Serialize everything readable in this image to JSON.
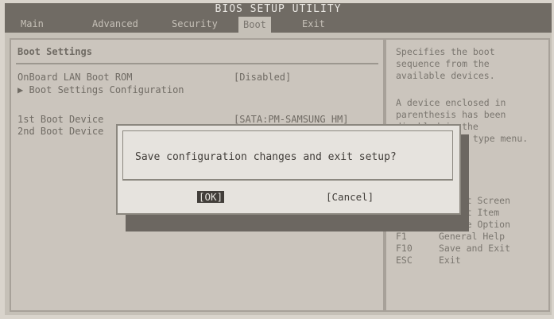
{
  "title": "BIOS SETUP UTILITY",
  "menu": {
    "items": [
      "Main",
      "Advanced",
      "Security",
      "Boot",
      "Exit"
    ],
    "active": "Boot"
  },
  "left": {
    "heading": "Boot Settings",
    "rows": [
      {
        "label": "OnBoard LAN Boot ROM",
        "value": "[Disabled]"
      },
      {
        "label": "▶ Boot Settings Configuration",
        "value": ""
      },
      {
        "label": "1st Boot Device",
        "value": "[SATA:PM-SAMSUNG HM]"
      },
      {
        "label": "2nd Boot Device",
        "value": ""
      }
    ]
  },
  "help": {
    "p1": "Specifies the boot sequence from the available devices.",
    "p2": "A device enclosed in parenthesis has been disabled in the corresponding type menu.",
    "keys": [
      {
        "key": "←→",
        "desc": "Select Screen"
      },
      {
        "key": "↑↓",
        "desc": "Select Item"
      },
      {
        "key": "+-",
        "desc": "Change Option"
      },
      {
        "key": "F1",
        "desc": "General Help"
      },
      {
        "key": "F10",
        "desc": "Save and Exit"
      },
      {
        "key": "ESC",
        "desc": "Exit"
      }
    ]
  },
  "dialog": {
    "message": "Save configuration changes and exit setup?",
    "ok_label": "[OK]",
    "cancel_label": "[Cancel]"
  }
}
